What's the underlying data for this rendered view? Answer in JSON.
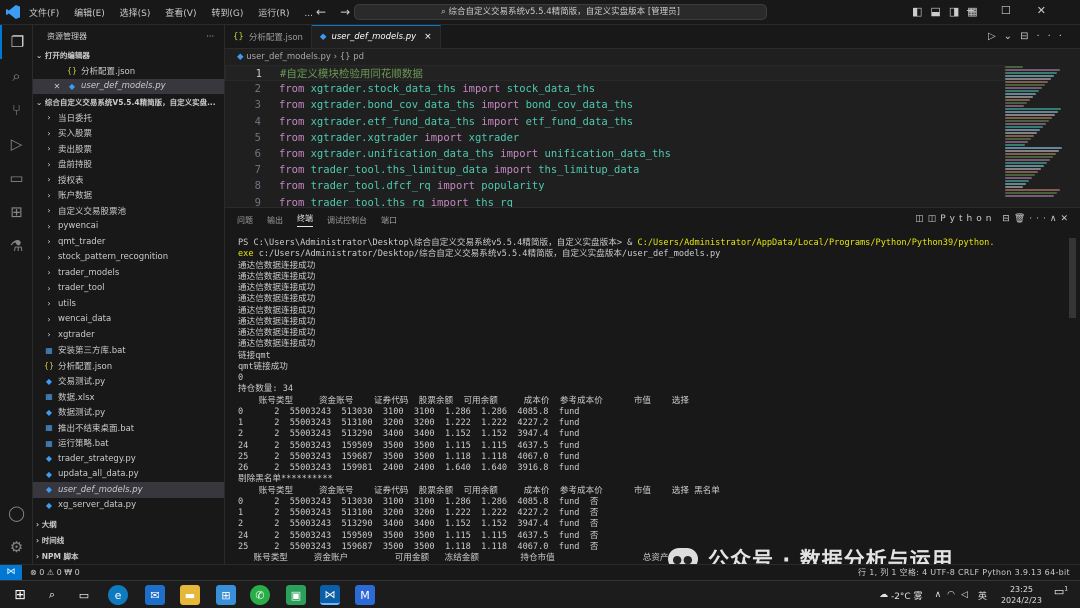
{
  "window": {
    "menu": [
      "文件(F)",
      "编辑(E)",
      "选择(S)",
      "查看(V)",
      "转到(G)",
      "运行(R)",
      "..."
    ],
    "command_center": "综合自定义交易系统v5.5.4精简版，自定义实盘版本 [管理员]"
  },
  "sidebar": {
    "title": "资源管理器",
    "open_editors_header": "打开的编辑器",
    "open_editors": [
      {
        "label": "分析配置.json",
        "icon": "{}",
        "selected": false
      },
      {
        "label": "user_def_models.py",
        "icon": "◆",
        "selected": true
      }
    ],
    "workspace_header": "综合自定义交易系统V5.5.4精简版，自定义实盘...",
    "items": [
      {
        "label": "当日委托",
        "icon": "›"
      },
      {
        "label": "买入股票",
        "icon": "›"
      },
      {
        "label": "卖出股票",
        "icon": "›"
      },
      {
        "label": "盘前持股",
        "icon": "›"
      },
      {
        "label": "授权表",
        "icon": "›"
      },
      {
        "label": "账户数据",
        "icon": "›"
      },
      {
        "label": "自定义交易股票池",
        "icon": "›"
      },
      {
        "label": "pywencai",
        "icon": "›"
      },
      {
        "label": "qmt_trader",
        "icon": "›"
      },
      {
        "label": "stock_pattern_recognition",
        "icon": "›"
      },
      {
        "label": "trader_models",
        "icon": "›"
      },
      {
        "label": "trader_tool",
        "icon": "›"
      },
      {
        "label": "utils",
        "icon": "›"
      },
      {
        "label": "wencai_data",
        "icon": "›"
      },
      {
        "label": "xgtrader",
        "icon": "›"
      },
      {
        "label": "安装第三方库.bat",
        "icon": "▦"
      },
      {
        "label": "分析配置.json",
        "icon": "{}"
      },
      {
        "label": "交易测试.py",
        "icon": "◆"
      },
      {
        "label": "数据.xlsx",
        "icon": "▦"
      },
      {
        "label": "数据测试.py",
        "icon": "◆"
      },
      {
        "label": "推出不结束桌面.bat",
        "icon": "▦"
      },
      {
        "label": "运行策略.bat",
        "icon": "▦"
      },
      {
        "label": "trader_strategy.py",
        "icon": "◆"
      },
      {
        "label": "updata_all_data.py",
        "icon": "◆"
      },
      {
        "label": "user_def_models.py",
        "icon": "◆",
        "selected": true
      },
      {
        "label": "xg_server_data.py",
        "icon": "◆"
      }
    ],
    "bottom_sections": [
      "大纲",
      "时间线",
      "NPM 脚本"
    ]
  },
  "editor": {
    "tabs": [
      {
        "label": "分析配置.json",
        "icon": "{}",
        "active": false
      },
      {
        "label": "user_def_models.py",
        "icon": "◆",
        "active": true,
        "close": "×"
      }
    ],
    "breadcrumb": [
      "user_def_models.py",
      "{} pd"
    ],
    "lines": [
      {
        "n": "1",
        "tokens": [
          {
            "t": "#自定义模块检验用同花顺数据",
            "c": "cmt"
          }
        ]
      },
      {
        "n": "2",
        "tokens": [
          {
            "t": "from ",
            "c": "kw"
          },
          {
            "t": "xgtrader.stock_data_ths",
            "c": "mod"
          },
          {
            "t": " import ",
            "c": "kw"
          },
          {
            "t": "stock_data_ths",
            "c": "idn"
          }
        ]
      },
      {
        "n": "3",
        "tokens": [
          {
            "t": "from ",
            "c": "kw"
          },
          {
            "t": "xgtrader.bond_cov_data_ths",
            "c": "mod"
          },
          {
            "t": " import ",
            "c": "kw"
          },
          {
            "t": "bond_cov_data_ths",
            "c": "idn"
          }
        ]
      },
      {
        "n": "4",
        "tokens": [
          {
            "t": "from ",
            "c": "kw"
          },
          {
            "t": "xgtrader.etf_fund_data_ths",
            "c": "mod"
          },
          {
            "t": " import ",
            "c": "kw"
          },
          {
            "t": "etf_fund_data_ths",
            "c": "idn"
          }
        ]
      },
      {
        "n": "5",
        "tokens": [
          {
            "t": "from ",
            "c": "kw"
          },
          {
            "t": "xgtrader.xgtrader",
            "c": "mod"
          },
          {
            "t": " import ",
            "c": "kw"
          },
          {
            "t": "xgtrader",
            "c": "idn"
          }
        ]
      },
      {
        "n": "6",
        "tokens": [
          {
            "t": "from ",
            "c": "kw"
          },
          {
            "t": "xgtrader.unification_data_ths",
            "c": "mod"
          },
          {
            "t": " import ",
            "c": "kw"
          },
          {
            "t": "unification_data_ths",
            "c": "idn"
          }
        ]
      },
      {
        "n": "7",
        "tokens": [
          {
            "t": "from ",
            "c": "kw"
          },
          {
            "t": "trader_tool.ths_limitup_data",
            "c": "mod"
          },
          {
            "t": " import ",
            "c": "kw"
          },
          {
            "t": "ths_limitup_data",
            "c": "idn"
          }
        ]
      },
      {
        "n": "8",
        "tokens": [
          {
            "t": "from ",
            "c": "kw"
          },
          {
            "t": "trader_tool.dfcf_rq",
            "c": "mod"
          },
          {
            "t": " import ",
            "c": "kw"
          },
          {
            "t": "popularity",
            "c": "idn"
          }
        ]
      },
      {
        "n": "9",
        "tokens": [
          {
            "t": "from ",
            "c": "kw"
          },
          {
            "t": "trader_tool.ths_rq",
            "c": "mod"
          },
          {
            "t": " import ",
            "c": "kw"
          },
          {
            "t": "ths_rq",
            "c": "idn"
          }
        ]
      }
    ]
  },
  "panel": {
    "tabs": [
      "问题",
      "输出",
      "终端",
      "调试控制台",
      "端口"
    ],
    "active_tab": "终端",
    "shell_label": "Python",
    "terminal": [
      {
        "t": "PS C:\\Users\\Administrator\\Desktop\\综合自定义交易系统v5.5.4精简版，自定义实盘版本> & ",
        "yl": "C:/Users/Administrator/AppData/Local/Programs/Python/Python39/python."
      },
      {
        "t": "",
        "yl": "exe",
        "rest": " c:/Users/Administrator/Desktop/综合自定义交易系统v5.5.4精简版，自定义实盘版本/user_def_models.py"
      },
      {
        "t": "通达信数据连接成功"
      },
      {
        "t": "通达信数据连接成功"
      },
      {
        "t": "通达信数据连接成功"
      },
      {
        "t": "通达信数据连接成功"
      },
      {
        "t": "通达信数据连接成功"
      },
      {
        "t": "通达信数据连接成功"
      },
      {
        "t": "通达信数据连接成功"
      },
      {
        "t": "通达信数据连接成功"
      },
      {
        "t": "链接qmt"
      },
      {
        "t": "qmt链接成功"
      },
      {
        "t": "0"
      },
      {
        "t": "持仓数量: 34"
      },
      {
        "t": "    账号类型     资金账号    证券代码  股票余额  可用余额     成本价  参考成本价      市值    选择"
      },
      {
        "t": "0      2  55003243  513030  3100  3100  1.286  1.286  4085.8  fund"
      },
      {
        "t": "1      2  55003243  513100  3200  3200  1.222  1.222  4227.2  fund"
      },
      {
        "t": "2      2  55003243  513290  3400  3400  1.152  1.152  3947.4  fund"
      },
      {
        "t": "24     2  55003243  159509  3500  3500  1.115  1.115  4637.5  fund"
      },
      {
        "t": "25     2  55003243  159687  3500  3500  1.118  1.118  4067.0  fund"
      },
      {
        "t": "26     2  55003243  159981  2400  2400  1.640  1.640  3916.8  fund"
      },
      {
        "t": "剔除黑名单**********"
      },
      {
        "t": "    账号类型     资金账号    证券代码  股票余额  可用余额     成本价  参考成本价      市值    选择 黑名单"
      },
      {
        "t": "0      2  55003243  513030  3100  3100  1.286  1.286  4085.8  fund  否"
      },
      {
        "t": "1      2  55003243  513100  3200  3200  1.222  1.222  4227.2  fund  否"
      },
      {
        "t": "2      2  55003243  513290  3400  3400  1.152  1.152  3947.4  fund  否"
      },
      {
        "t": "24     2  55003243  159509  3500  3500  1.115  1.115  4637.5  fund  否"
      },
      {
        "t": "25     2  55003243  159687  3500  3500  1.118  1.118  4067.0  fund  否"
      },
      {
        "t": "   账号类型     资金账户         可用金额   冻结金额        持仓市值                 总资产"
      }
    ]
  },
  "statusbar": {
    "left": "⊗ 0 ⚠ 0   ₩ 0",
    "right": "行 1, 列 1   空格: 4   UTF-8   CRLF   Python   3.9.13 64-bit"
  },
  "taskbar": {
    "weather": "-2°C 雾",
    "ime": "英",
    "time": "23:25",
    "date": "2024/2/23",
    "notifications": "1"
  },
  "watermark": "公众号 · 数据分析与运用",
  "colors": {
    "accent": "#0078d4",
    "keyword": "#c586c0",
    "module": "#4ec9b0",
    "comment": "#6a9955"
  }
}
